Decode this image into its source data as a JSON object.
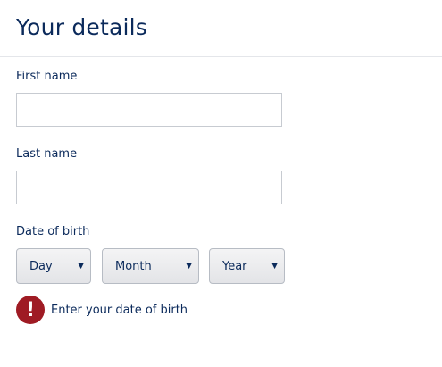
{
  "page": {
    "title": "Your details"
  },
  "form": {
    "first_name": {
      "label": "First name",
      "value": "",
      "placeholder": ""
    },
    "last_name": {
      "label": "Last name",
      "value": "",
      "placeholder": ""
    },
    "dob": {
      "label": "Date of birth",
      "day": "Day",
      "month": "Month",
      "year": "Year"
    },
    "error": {
      "icon": "exclamation-icon",
      "symbol": "!",
      "message": "Enter your date of birth"
    }
  },
  "colors": {
    "text": "#0b2a5b",
    "error": "#9f1b24",
    "border": "#c7cbd1"
  }
}
